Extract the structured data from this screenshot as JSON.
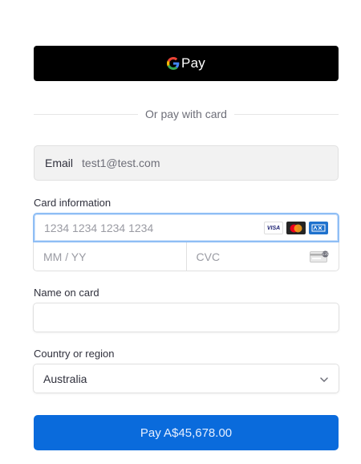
{
  "gpay": {
    "label": "Pay",
    "icon": "google-g-icon"
  },
  "divider": {
    "text": "Or pay with card"
  },
  "email": {
    "label": "Email",
    "value": "test1@test.com"
  },
  "card": {
    "label": "Card information",
    "number_placeholder": "1234 1234 1234 1234",
    "expiry_placeholder": "MM / YY",
    "cvc_placeholder": "CVC",
    "brands": [
      "visa",
      "mastercard",
      "amex"
    ],
    "visa_text": "VISA"
  },
  "name_on_card": {
    "label": "Name on card",
    "value": ""
  },
  "country": {
    "label": "Country or region",
    "value": "Australia"
  },
  "pay_button": {
    "label": "Pay A$45,678.00"
  },
  "colors": {
    "pay_button": "#0a6bdc",
    "gpay_button": "#000000",
    "focus_border": "#8fbef5"
  }
}
